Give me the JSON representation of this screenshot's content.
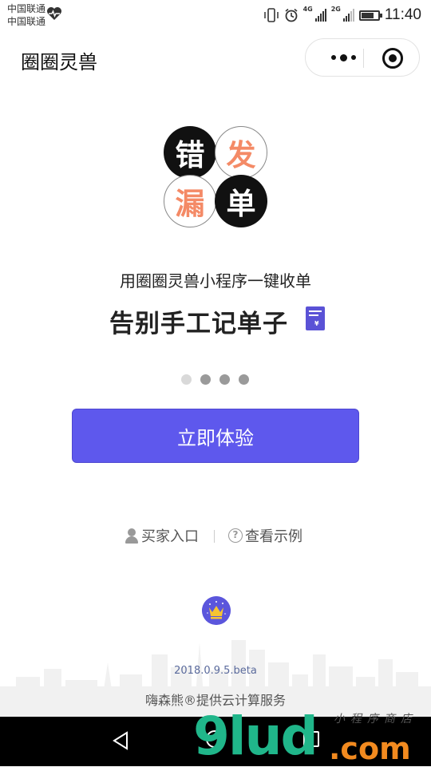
{
  "status_bar": {
    "carrier_line1": "中国联通",
    "carrier_line2": "中国联通",
    "net_4g": "4G",
    "net_2g": "2G",
    "time": "11:40"
  },
  "nav": {
    "title": "圈圈灵兽"
  },
  "logo": {
    "chars": [
      "错",
      "发",
      "漏",
      "单"
    ]
  },
  "promo": {
    "subtitle": "用圈圈灵兽小程序一键收单",
    "headline": "告别手工记单子",
    "receipt_symbol": "¥"
  },
  "carousel": {
    "count": 4,
    "active_index": 0
  },
  "cta": {
    "label": "立即体验"
  },
  "links": {
    "buyer": "买家入口",
    "demo": "查看示例"
  },
  "footer": {
    "version": "2018.0.9.5.beta",
    "provider": "嗨森熊®提供云计算服务"
  },
  "watermark": {
    "main": "9lud",
    "suffix": ".com",
    "tag": "小程序商店"
  },
  "colors": {
    "accent": "#5e58ed",
    "logo_orange": "#f48a66",
    "watermark_green": "#20b68a",
    "watermark_orange": "#f28a1f"
  }
}
